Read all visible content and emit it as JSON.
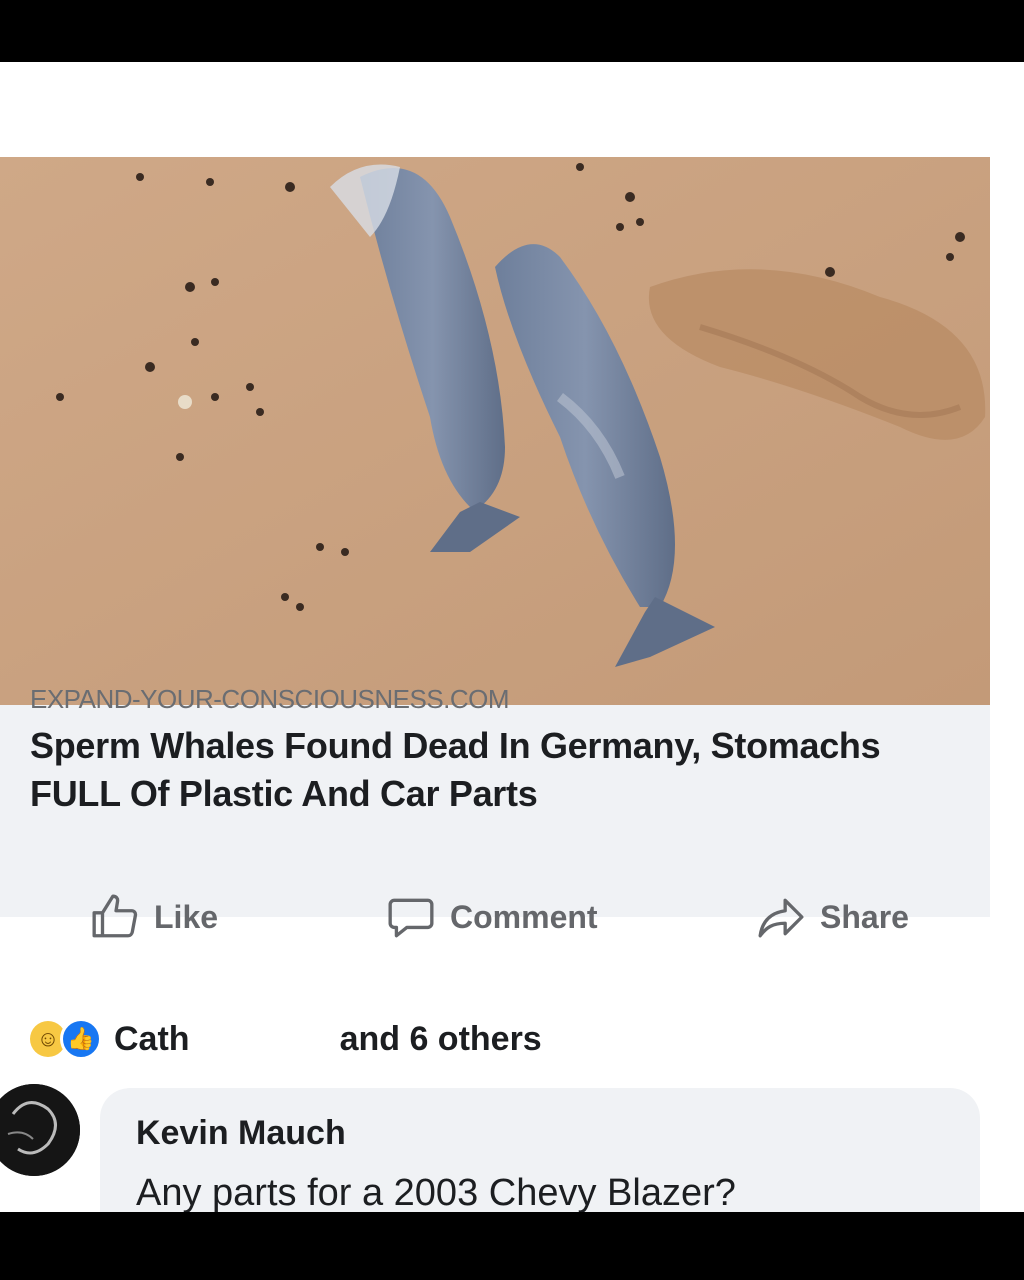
{
  "post": {
    "image_alt": "Aerial view of two whales on a beach",
    "link_domain": "EXPAND-YOUR-CONSCIOUSNESS.COM",
    "headline": "Sperm Whales Found Dead In Germany, Stomachs FULL Of Plastic And Car Parts"
  },
  "actions": {
    "like_label": "Like",
    "comment_label": "Comment",
    "share_label": "Share"
  },
  "reactions": {
    "first_name": "Cath",
    "others_text": "and 6 others"
  },
  "comment": {
    "author": "Kevin Mauch",
    "text": "Any parts for a 2003 Chevy Blazer?"
  },
  "colors": {
    "like_blue": "#1877f2",
    "haha_yellow": "#f7c843",
    "sand": "#c9a07f"
  }
}
